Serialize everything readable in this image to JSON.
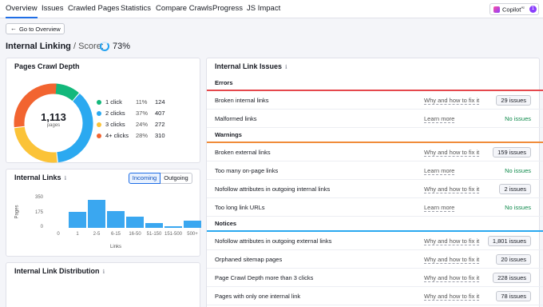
{
  "nav": {
    "tabs": [
      "Overview",
      "Issues",
      "Crawled Pages",
      "Statistics",
      "Compare Crawls",
      "Progress",
      "JS Impact"
    ],
    "active": "Overview",
    "copilot_label": "Copilot",
    "copilot_sup": "AI",
    "copilot_count": "1"
  },
  "back_button": "Go to Overview",
  "header": {
    "title": "Internal Linking",
    "separator": " / Score:",
    "score": "73%"
  },
  "crawl_depth": {
    "title": "Pages Crawl Depth",
    "total": "1,113",
    "total_label": "pages",
    "items": [
      {
        "label": "1 click",
        "pct": "11%",
        "count": "124",
        "color": "#13b87b"
      },
      {
        "label": "2 clicks",
        "pct": "37%",
        "count": "407",
        "color": "#2ba9f0"
      },
      {
        "label": "3 clicks",
        "pct": "24%",
        "count": "272",
        "color": "#fbc338"
      },
      {
        "label": "4+ clicks",
        "pct": "28%",
        "count": "310",
        "color": "#f26430"
      }
    ]
  },
  "internal_links": {
    "title": "Internal Links",
    "toggle": [
      "Incoming",
      "Outgoing"
    ],
    "toggle_active": "Incoming"
  },
  "chart_data": {
    "type": "bar",
    "categories": [
      "0",
      "1",
      "2-5",
      "6-15",
      "16-50",
      "51-150",
      "151-500",
      "500+"
    ],
    "values": [
      0,
      185,
      330,
      200,
      135,
      60,
      20,
      85
    ],
    "xlabel": "Links",
    "ylabel": "Pages",
    "yticks": [
      "350",
      "175",
      "0"
    ],
    "ylim": [
      0,
      350
    ],
    "color": "#3aa7f0"
  },
  "distribution": {
    "title": "Internal Link Distribution"
  },
  "issues": {
    "title": "Internal Link Issues",
    "sections": [
      {
        "name": "Errors",
        "color": "#e5484d",
        "rows": [
          {
            "name": "Broken internal links",
            "link": "Why and how to fix it",
            "value": "29 issues",
            "ok": false
          },
          {
            "name": "Malformed links",
            "link": "Learn more",
            "value": "No issues",
            "ok": true
          }
        ]
      },
      {
        "name": "Warnings",
        "color": "#f08c3a",
        "rows": [
          {
            "name": "Broken external links",
            "link": "Why and how to fix it",
            "value": "159 issues",
            "ok": false
          },
          {
            "name": "Too many on-page links",
            "link": "Learn more",
            "value": "No issues",
            "ok": true
          },
          {
            "name": "Nofollow attributes in outgoing internal links",
            "link": "Why and how to fix it",
            "value": "2 issues",
            "ok": false
          },
          {
            "name": "Too long link URLs",
            "link": "Learn more",
            "value": "No issues",
            "ok": true
          }
        ]
      },
      {
        "name": "Notices",
        "color": "#2ba9f0",
        "rows": [
          {
            "name": "Nofollow attributes in outgoing external links",
            "link": "Why and how to fix it",
            "value": "1,801 issues",
            "ok": false
          },
          {
            "name": "Orphaned sitemap pages",
            "link": "Why and how to fix it",
            "value": "20 issues",
            "ok": false
          },
          {
            "name": "Page Crawl Depth more than 3 clicks",
            "link": "Why and how to fix it",
            "value": "228 issues",
            "ok": false
          },
          {
            "name": "Pages with only one internal link",
            "link": "Why and how to fix it",
            "value": "78 issues",
            "ok": false
          }
        ]
      }
    ]
  }
}
